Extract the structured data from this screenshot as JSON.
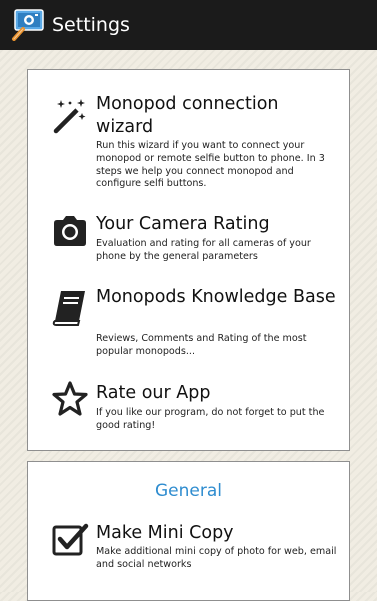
{
  "appbar": {
    "title": "Settings",
    "icon": "selfie-stick-camera-icon"
  },
  "main": {
    "items": [
      {
        "title": "Monopod connection wizard",
        "description": "Run this wizard if you want to connect your monopod or remote selfie button to phone. In 3 steps we help you connect monopod and configure selfi buttons.",
        "icon": "magic-wand-icon"
      },
      {
        "title": "Your Camera Rating",
        "description": "Evaluation and rating for all cameras of your phone by the general parameters",
        "icon": "camera-icon"
      },
      {
        "title": "Monopods Knowledge Base",
        "description": "Reviews, Comments and Rating of the most popular monopods...",
        "icon": "book-icon"
      },
      {
        "title": "Rate our App",
        "description": "If you like our program, do not forget to put the good rating!",
        "icon": "star-icon"
      }
    ]
  },
  "general": {
    "section_title": "General",
    "items": [
      {
        "title": "Make Mini Copy",
        "description": "Make additional mini copy of photo for web, email and social networks",
        "icon": "checkbox-checked-icon"
      }
    ]
  },
  "colors": {
    "appbar": "#1b1b1b",
    "accent": "#2e8ccf",
    "background": "#f1ede3"
  }
}
